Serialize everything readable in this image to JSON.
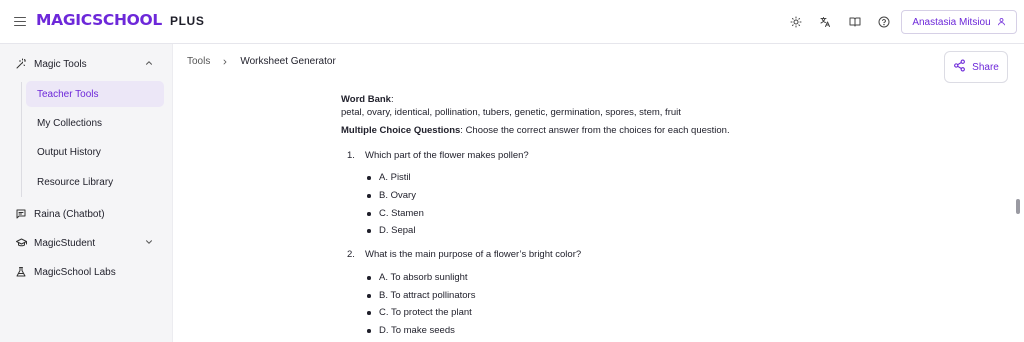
{
  "header": {
    "logo_main": "MAGICSCHOOL",
    "logo_plus": "PLUS",
    "user_name": "Anastasia Mitsiou"
  },
  "sidebar": {
    "magic_tools": "Magic Tools",
    "sub_items": [
      "Teacher Tools",
      "My Collections",
      "Output History",
      "Resource Library"
    ],
    "raina": "Raina (Chatbot)",
    "magic_student": "MagicStudent",
    "labs": "MagicSchool Labs"
  },
  "breadcrumb": {
    "root": "Tools",
    "current": "Worksheet Generator"
  },
  "share_label": "Share",
  "worksheet": {
    "word_bank_label": "Word Bank",
    "word_bank_colon": ":",
    "word_bank_words": "petal, ovary, identical, pollination, tubers, genetic, germination, spores, stem, fruit",
    "mcq_label": "Multiple Choice Questions",
    "mcq_instruction": ": Choose the correct answer from the choices for each question.",
    "questions": [
      {
        "num": "1.",
        "text": "Which part of the flower makes pollen?",
        "options": [
          "A. Pistil",
          "B. Ovary",
          "C. Stamen",
          "D. Sepal"
        ]
      },
      {
        "num": "2.",
        "text": "What is the main purpose of a flower’s bright color?",
        "options": [
          "A. To absorb sunlight",
          "B. To attract pollinators",
          "C. To protect the plant",
          "D. To make seeds"
        ]
      }
    ]
  },
  "colors": {
    "accent": "#6d28d9",
    "active_bg": "#ece7f7",
    "sidebar_bg": "#f5f5f7"
  },
  "icons": [
    "menu-icon",
    "sun-icon",
    "translate-icon",
    "book-icon",
    "help-icon",
    "user-icon",
    "wand-icon",
    "chevron-up-icon",
    "chat-icon",
    "graduation-cap-icon",
    "chevron-down-icon",
    "flask-icon",
    "chevron-right-icon",
    "share-icon"
  ]
}
